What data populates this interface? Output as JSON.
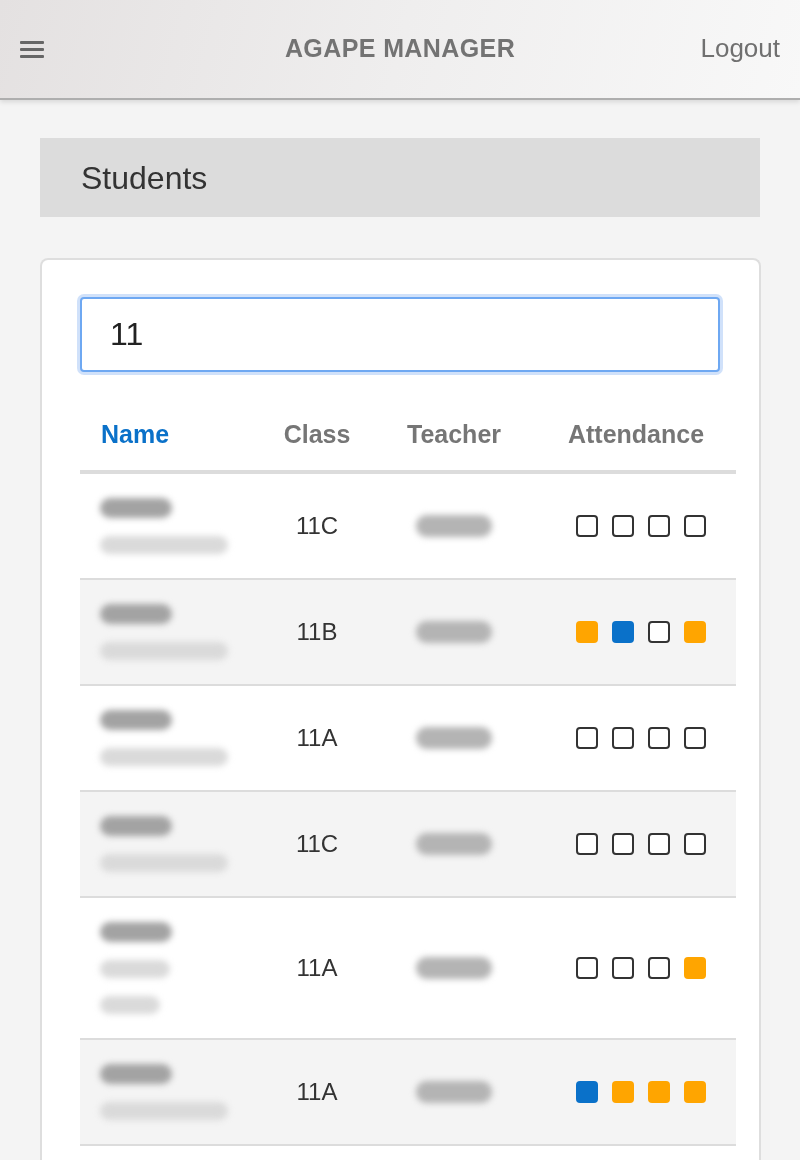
{
  "navbar": {
    "title": "AGAPE MANAGER",
    "logout": "Logout"
  },
  "page_title": "Students",
  "search": {
    "value": "11"
  },
  "table": {
    "columns": [
      {
        "label": "Name",
        "selected": true
      },
      {
        "label": "Class",
        "selected": false
      },
      {
        "label": "Teacher",
        "selected": false
      },
      {
        "label": "Attendance",
        "selected": false
      }
    ],
    "rows": [
      {
        "class": "11C",
        "name_wrapped": false,
        "attendance": [
          {
            "filled": false
          },
          {
            "filled": false
          },
          {
            "filled": false
          },
          {
            "filled": false
          }
        ]
      },
      {
        "class": "11B",
        "name_wrapped": false,
        "attendance": [
          {
            "filled": true,
            "color": "#ffa500"
          },
          {
            "filled": true,
            "color": "#0a71c9"
          },
          {
            "filled": false
          },
          {
            "filled": true,
            "color": "#ffa500"
          }
        ]
      },
      {
        "class": "11A",
        "name_wrapped": false,
        "attendance": [
          {
            "filled": false
          },
          {
            "filled": false
          },
          {
            "filled": false
          },
          {
            "filled": false
          }
        ]
      },
      {
        "class": "11C",
        "name_wrapped": false,
        "attendance": [
          {
            "filled": false
          },
          {
            "filled": false
          },
          {
            "filled": false
          },
          {
            "filled": false
          }
        ]
      },
      {
        "class": "11A",
        "name_wrapped": true,
        "attendance": [
          {
            "filled": false
          },
          {
            "filled": false
          },
          {
            "filled": false
          },
          {
            "filled": true,
            "color": "#ffa500"
          }
        ]
      },
      {
        "class": "11A",
        "name_wrapped": false,
        "attendance": [
          {
            "filled": true,
            "color": "#0a71c9"
          },
          {
            "filled": true,
            "color": "#ffa500"
          },
          {
            "filled": true,
            "color": "#ffa500"
          },
          {
            "filled": true,
            "color": "#ffa500"
          }
        ]
      }
    ]
  }
}
